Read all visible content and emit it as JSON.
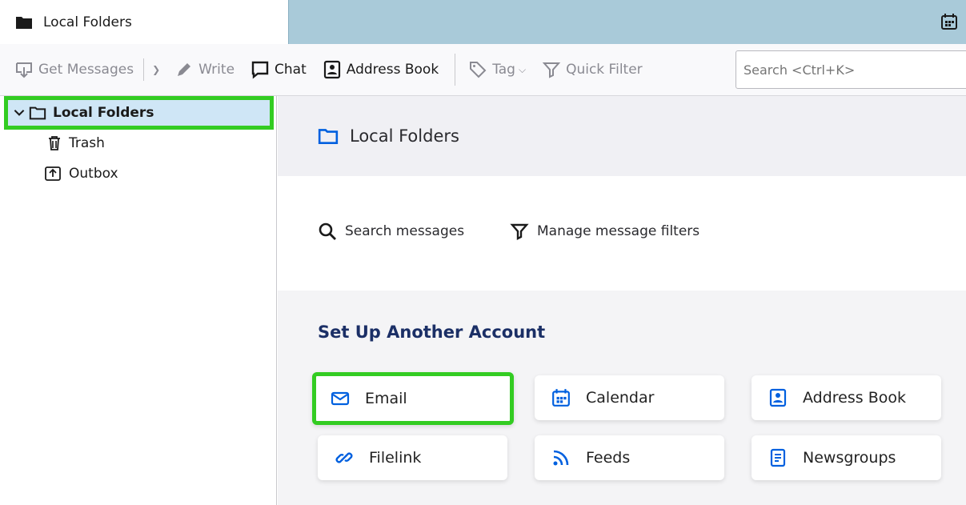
{
  "tab": {
    "label": "Local Folders"
  },
  "toolbar": {
    "get_messages": "Get Messages",
    "write": "Write",
    "chat": "Chat",
    "address_book": "Address Book",
    "tag": "Tag",
    "quick_filter": "Quick Filter",
    "search_placeholder": "Search <Ctrl+K>"
  },
  "folders": {
    "root": "Local Folders",
    "trash": "Trash",
    "outbox": "Outbox"
  },
  "main": {
    "header_title": "Local Folders",
    "search_messages": "Search messages",
    "manage_filters": "Manage message filters",
    "setup_title": "Set Up Another Account",
    "cards": {
      "email": "Email",
      "calendar": "Calendar",
      "address_book": "Address Book",
      "filelink": "Filelink",
      "feeds": "Feeds",
      "newsgroups": "Newsgroups"
    }
  },
  "colors": {
    "accent": "#0060df",
    "highlight": "#33cc22",
    "setup_title": "#1b2f66"
  }
}
